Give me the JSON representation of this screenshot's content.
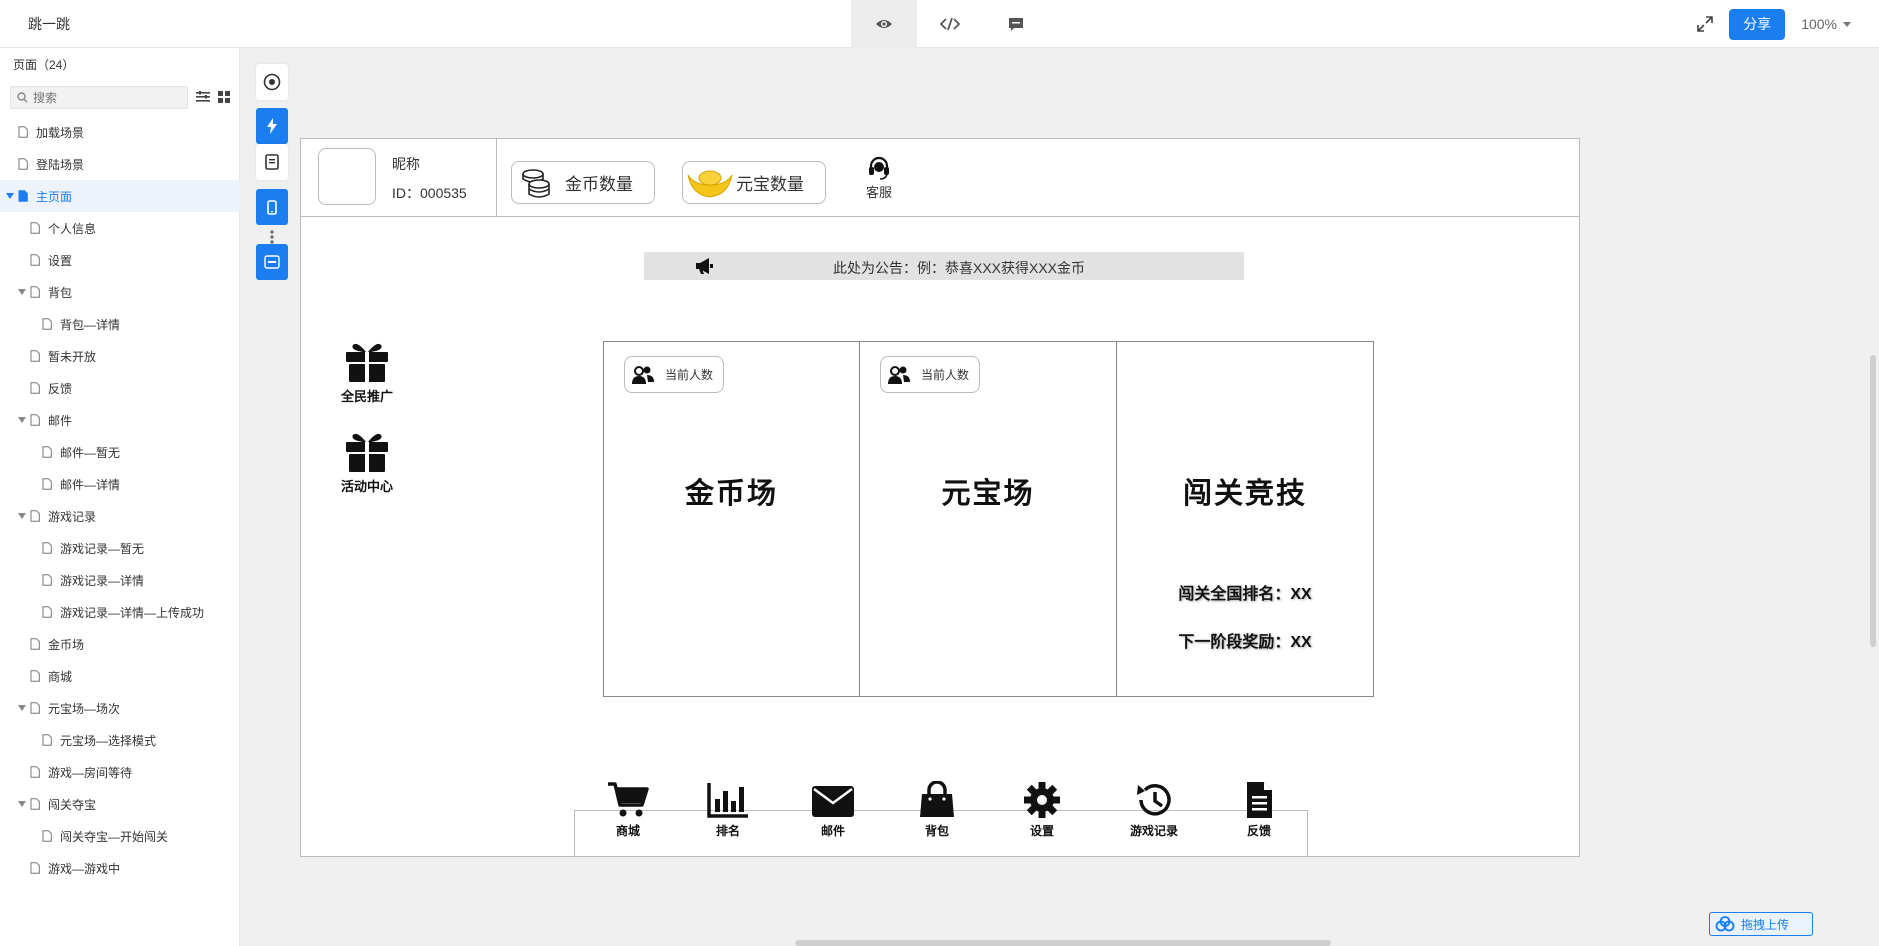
{
  "app": {
    "title": "跳一跳",
    "share_label": "分享",
    "zoom_label": "100%"
  },
  "view_tabs": [
    {
      "name": "preview-tab",
      "icon": "eye-icon"
    },
    {
      "name": "code-tab",
      "icon": "code-icon"
    },
    {
      "name": "comment-tab",
      "icon": "comment-icon"
    }
  ],
  "sidebar": {
    "header": "页面（24）",
    "search_placeholder": "搜索",
    "items": [
      {
        "label": "加载场景",
        "level": 0,
        "expandable": false,
        "active": false
      },
      {
        "label": "登陆场景",
        "level": 0,
        "expandable": false,
        "active": false
      },
      {
        "label": "主页面",
        "level": 0,
        "expandable": true,
        "active": true
      },
      {
        "label": "个人信息",
        "level": 1,
        "expandable": false,
        "active": false
      },
      {
        "label": "设置",
        "level": 1,
        "expandable": false,
        "active": false
      },
      {
        "label": "背包",
        "level": 1,
        "expandable": true,
        "active": false
      },
      {
        "label": "背包—详情",
        "level": 2,
        "expandable": false,
        "active": false
      },
      {
        "label": "暂未开放",
        "level": 1,
        "expandable": false,
        "active": false
      },
      {
        "label": "反馈",
        "level": 1,
        "expandable": false,
        "active": false
      },
      {
        "label": "邮件",
        "level": 1,
        "expandable": true,
        "active": false
      },
      {
        "label": "邮件—暂无",
        "level": 2,
        "expandable": false,
        "active": false
      },
      {
        "label": "邮件—详情",
        "level": 2,
        "expandable": false,
        "active": false
      },
      {
        "label": "游戏记录",
        "level": 1,
        "expandable": true,
        "active": false
      },
      {
        "label": "游戏记录—暂无",
        "level": 2,
        "expandable": false,
        "active": false
      },
      {
        "label": "游戏记录—详情",
        "level": 2,
        "expandable": false,
        "active": false
      },
      {
        "label": "游戏记录—详情—上传成功",
        "level": 2,
        "expandable": false,
        "active": false
      },
      {
        "label": "金币场",
        "level": 1,
        "expandable": false,
        "active": false
      },
      {
        "label": "商城",
        "level": 1,
        "expandable": false,
        "active": false
      },
      {
        "label": "元宝场—场次",
        "level": 1,
        "expandable": true,
        "active": false
      },
      {
        "label": "元宝场—选择模式",
        "level": 2,
        "expandable": false,
        "active": false
      },
      {
        "label": "游戏—房间等待",
        "level": 1,
        "expandable": false,
        "active": false
      },
      {
        "label": "闯关夺宝",
        "level": 1,
        "expandable": true,
        "active": false
      },
      {
        "label": "闯关夺宝—开始闯关",
        "level": 2,
        "expandable": false,
        "active": false
      },
      {
        "label": "游戏—游戏中",
        "level": 1,
        "expandable": false,
        "active": false
      }
    ]
  },
  "canvas": {
    "profile": {
      "nickname": "昵称",
      "id_text": "ID：000535",
      "gold_label": "金币数量",
      "yuanbao_label": "元宝数量",
      "service_label": "客服"
    },
    "notice": "此处为公告：例：恭喜XXX获得XXX金币",
    "promos": [
      "全民推广",
      "活动中心"
    ],
    "modes": [
      {
        "title": "金币场",
        "players_label": "当前人数"
      },
      {
        "title": "元宝场",
        "players_label": "当前人数"
      },
      {
        "title": "闯关竞技",
        "rank_text": "闯关全国排名：XX",
        "reward_text": "下一阶段奖励：XX"
      }
    ],
    "dock": [
      {
        "label": "商城",
        "icon": "cart-icon"
      },
      {
        "label": "排名",
        "icon": "bar-chart-icon"
      },
      {
        "label": "邮件",
        "icon": "mail-icon"
      },
      {
        "label": "背包",
        "icon": "bag-icon"
      },
      {
        "label": "设置",
        "icon": "gear-icon"
      },
      {
        "label": "游戏记录",
        "icon": "history-icon"
      },
      {
        "label": "反馈",
        "icon": "document-icon"
      }
    ]
  },
  "upload_label": "拖拽上传",
  "colors": {
    "accent": "#1a7ef0",
    "active_bg": "#eef3fb",
    "gold": "#f5c518"
  }
}
